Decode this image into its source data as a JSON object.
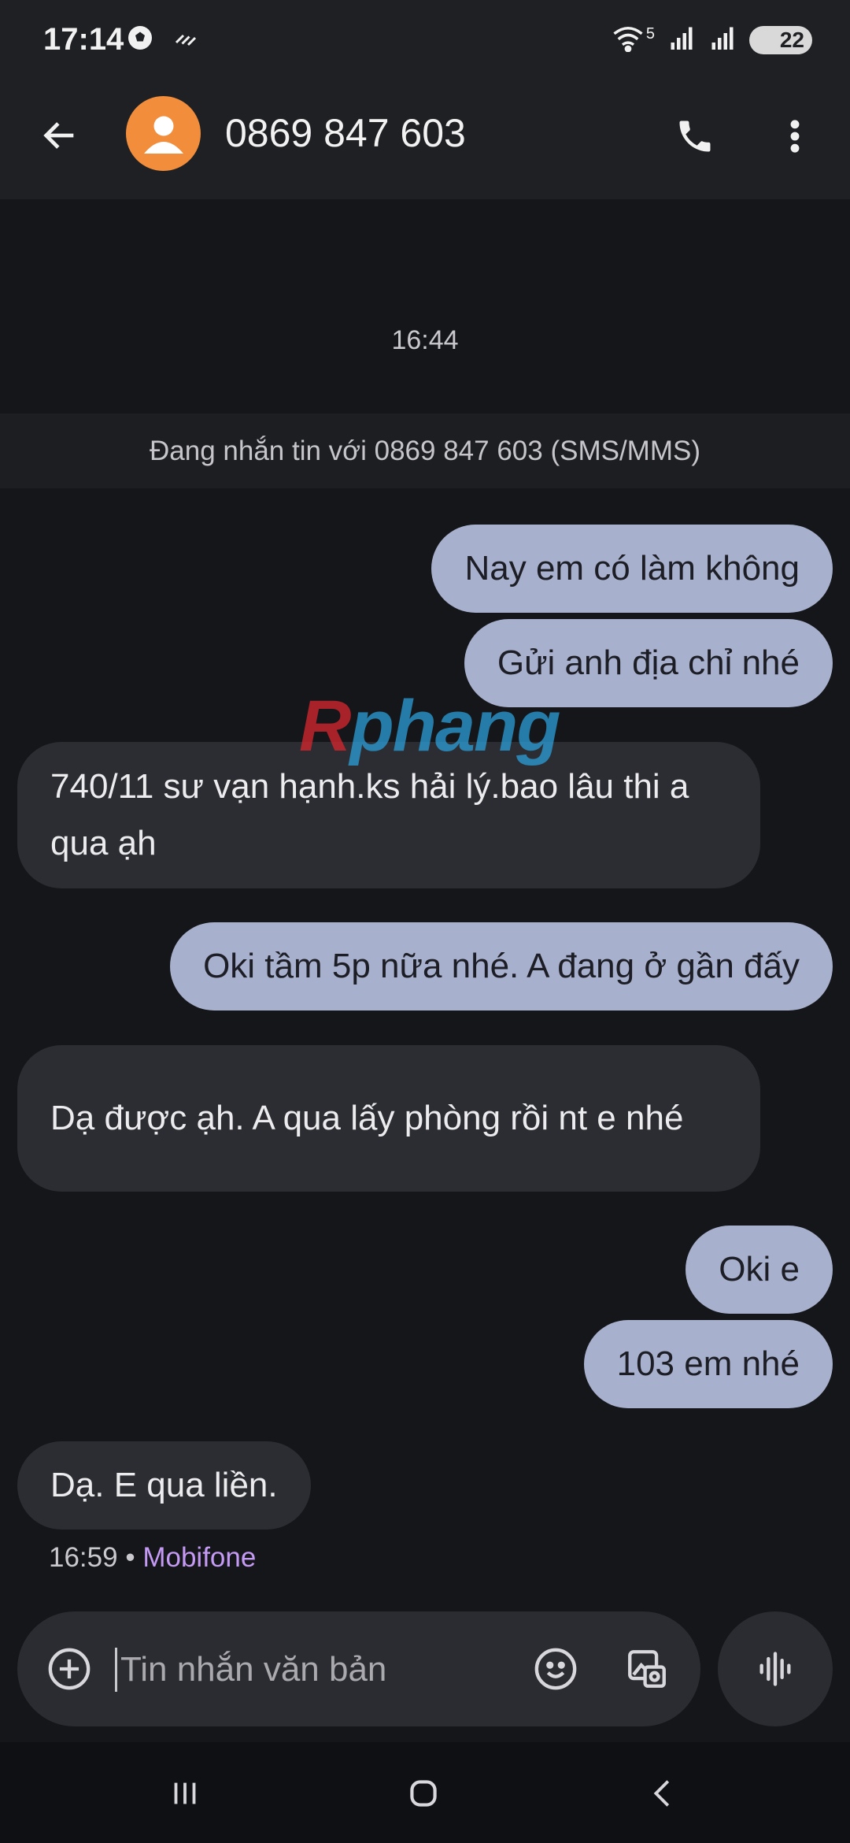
{
  "status_bar": {
    "time": "17:14",
    "battery": "22",
    "network": "5"
  },
  "header": {
    "contact": "0869 847 603"
  },
  "thread": {
    "timestamp": "16:44",
    "info_banner": "Đang nhắn tin với 0869 847 603 (SMS/MMS)",
    "messages": [
      {
        "dir": "out",
        "text": "Nay em có làm không"
      },
      {
        "dir": "out",
        "text": "Gửi anh địa chỉ nhé"
      },
      {
        "dir": "in",
        "text": "740/11 sư vạn hạnh.ks hải lý.bao lâu thi a qua ạh"
      },
      {
        "dir": "out",
        "text": "Oki tầm 5p nữa nhé. A đang ở gần đấy"
      },
      {
        "dir": "in",
        "text": "Dạ được ạh. A qua lấy phòng rồi nt e nhé"
      },
      {
        "dir": "out",
        "text": "Oki e"
      },
      {
        "dir": "out",
        "text": "103 em nhé"
      },
      {
        "dir": "in",
        "text": "Dạ. E qua liền."
      }
    ],
    "last_time": "16:59",
    "separator": "•",
    "carrier": "Mobifone"
  },
  "watermark": {
    "part1": "R",
    "part2": "phang"
  },
  "compose": {
    "placeholder": "Tin nhắn văn bản"
  },
  "colors": {
    "outgoing_bubble": "#a7b0cc",
    "incoming_bubble": "#2c2d32",
    "avatar": "#f28d3c",
    "carrier": "#c59af5"
  }
}
